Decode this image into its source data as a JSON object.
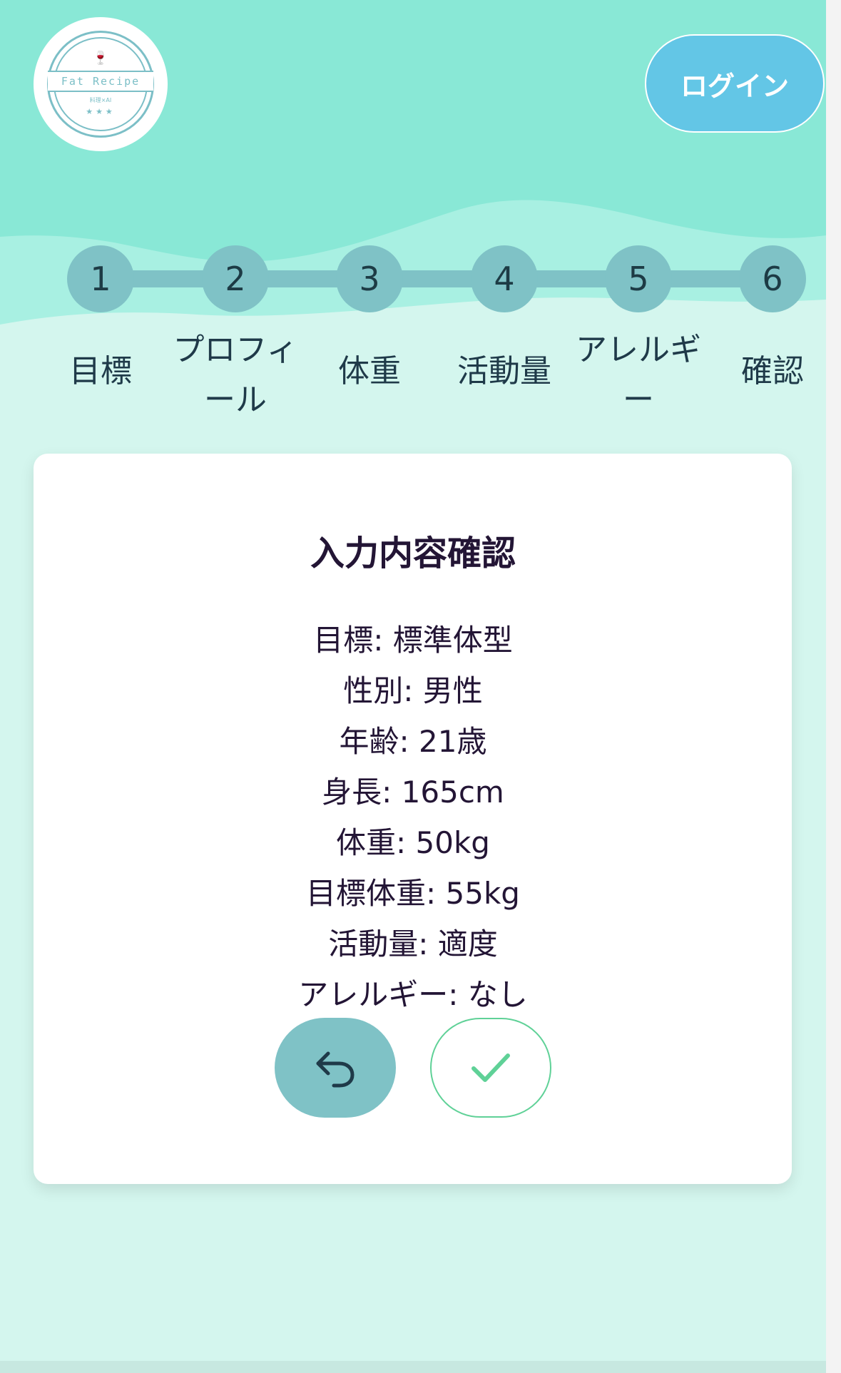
{
  "colors": {
    "header_teal": "#89e8d6",
    "wave_light": "#a8f0e2",
    "page_background": "#d4f6ee",
    "step_circle": "#7fc2c6",
    "login_button": "#63c6e6",
    "confirm_border": "#5fd197",
    "text_dark": "#231535"
  },
  "logo": {
    "text": "Fat Recipe",
    "subtext": "料理×AI",
    "stars": "★★★",
    "icon": "wine-glass-icon"
  },
  "header": {
    "login_label": "ログイン"
  },
  "stepper": {
    "steps": [
      {
        "number": "1",
        "label": "目標"
      },
      {
        "number": "2",
        "label": "プロフィ\nール"
      },
      {
        "number": "3",
        "label": "体重"
      },
      {
        "number": "4",
        "label": "活動量"
      },
      {
        "number": "5",
        "label": "アレルギ\nー"
      },
      {
        "number": "6",
        "label": "確認"
      }
    ]
  },
  "confirmation": {
    "title": "入力内容確認",
    "lines": [
      "目標: 標準体型",
      "性別: 男性",
      "年齢: 21歳",
      "身長: 165cm",
      "体重: 50kg",
      "目標体重: 55kg",
      "活動量: 適度",
      "アレルギー: なし"
    ],
    "back_icon": "undo-arrow-icon",
    "confirm_icon": "checkmark-icon"
  }
}
